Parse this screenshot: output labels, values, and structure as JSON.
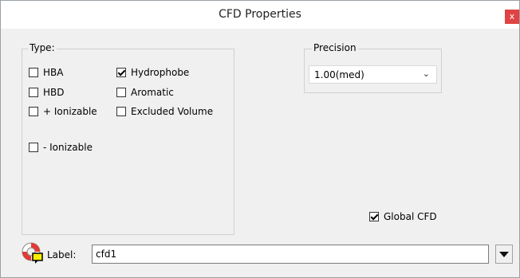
{
  "window": {
    "title": "CFD Properties",
    "close_label": "x"
  },
  "type_group": {
    "legend": "Type:",
    "options": [
      {
        "label": "HBA",
        "checked": false
      },
      {
        "label": "Hydrophobe",
        "checked": true
      },
      {
        "label": "HBD",
        "checked": false
      },
      {
        "label": "Aromatic",
        "checked": false
      },
      {
        "label": "+ Ionizable",
        "checked": false
      },
      {
        "label": "Excluded Volume",
        "checked": false
      },
      {
        "label": "- Ionizable",
        "checked": false
      }
    ]
  },
  "precision_group": {
    "legend": "Precision",
    "selected": "1.00(med)"
  },
  "global_cfd": {
    "label": "Global CFD",
    "checked": true
  },
  "label_row": {
    "label": "Label:",
    "value": "cfd1"
  },
  "icons": {
    "help": "lifebuoy-note-icon",
    "dropdown": "triangle-down-icon",
    "close": "close-icon",
    "select_chevron": "chevron-down-icon"
  },
  "colors": {
    "close_bg": "#e04343",
    "lifebuoy_red": "#e53935",
    "note_yellow": "#ffee00"
  }
}
